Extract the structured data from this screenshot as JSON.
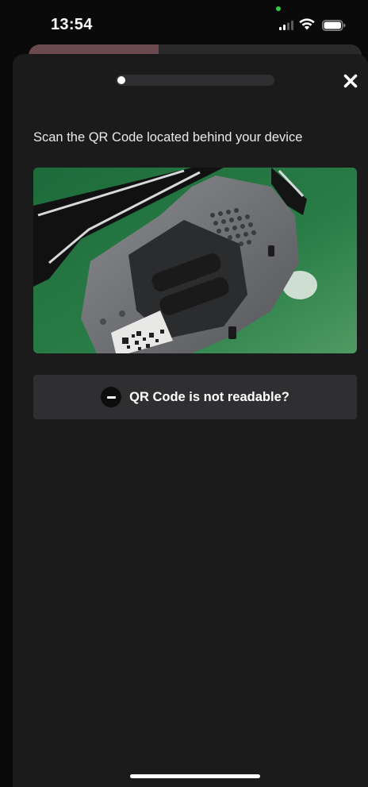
{
  "status_bar": {
    "time": "13:54",
    "signal_icon": "cellular-signal-icon",
    "wifi_icon": "wifi-icon",
    "battery_icon": "battery-icon"
  },
  "background_sheet": {
    "progress_fraction": 0.39,
    "progress_color": "#6b4a4f"
  },
  "modal": {
    "step_progress_fraction": 0.04,
    "close_icon": "close-icon",
    "instruction": "Scan the QR Code located behind your device",
    "photo_icon": "device-back-photo",
    "not_readable_button": {
      "icon": "minus-circle-icon",
      "label": "QR Code is not readable?"
    }
  },
  "colors": {
    "background": "#0a0a0a",
    "modal": "#1b1b1c",
    "button": "#2f2f31",
    "accent_status_dot": "#2ecc40"
  }
}
